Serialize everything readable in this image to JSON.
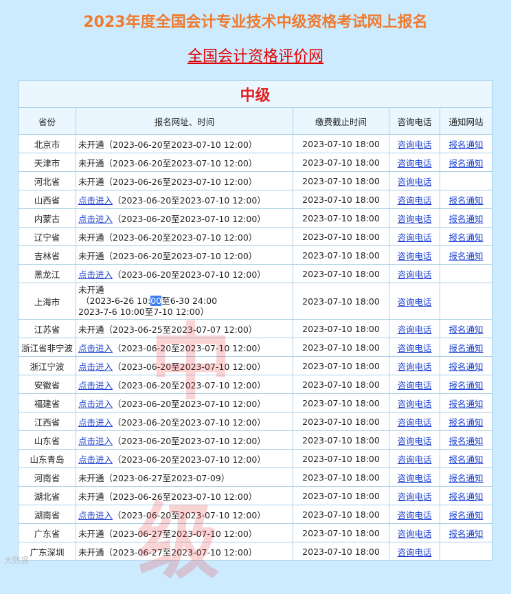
{
  "page": {
    "title": "2023年度全国会计专业技术中级资格考试网上报名",
    "subtitle_link": "全国会计资格评价网"
  },
  "table": {
    "level_title": "中级",
    "headers": [
      "省份",
      "报名网址、时间",
      "缴费截止时间",
      "咨询电话",
      "通知网站"
    ],
    "rows": [
      {
        "province": "北京市",
        "status": "未开通",
        "status_link": false,
        "period": "（2023-06-20至2023-07-10 12:00）",
        "payment_deadline": "2023-07-10 18:00",
        "tel": "咨询电话",
        "notice": "报名通知"
      },
      {
        "province": "天津市",
        "status": "未开通",
        "status_link": false,
        "period": "（2023-06-20至2023-07-10 12:00）",
        "payment_deadline": "2023-07-10 18:00",
        "tel": "咨询电话",
        "notice": "报名通知"
      },
      {
        "province": "河北省",
        "status": "未开通",
        "status_link": false,
        "period": "（2023-06-26至2023-07-10 12:00）",
        "payment_deadline": "2023-07-10 18:00",
        "tel": "咨询电话",
        "notice": ""
      },
      {
        "province": "山西省",
        "status": "点击进入",
        "status_link": true,
        "period": "（2023-06-20至2023-07-10 12:00）",
        "payment_deadline": "2023-07-10 18:00",
        "tel": "咨询电话",
        "notice": "报名通知"
      },
      {
        "province": "内蒙古",
        "status": "点击进入",
        "status_link": true,
        "period": "（2023-06-20至2023-07-10 12:00）",
        "payment_deadline": "2023-07-10 18:00",
        "tel": "咨询电话",
        "notice": "报名通知"
      },
      {
        "province": "辽宁省",
        "status": "未开通",
        "status_link": false,
        "period": "（2023-06-20至2023-07-10 12:00）",
        "payment_deadline": "2023-07-10 18:00",
        "tel": "咨询电话",
        "notice": "报名通知"
      },
      {
        "province": "吉林省",
        "status": "未开通",
        "status_link": false,
        "period": "（2023-06-20至2023-07-10 12:00）",
        "payment_deadline": "2023-07-10 18:00",
        "tel": "咨询电话",
        "notice": "报名通知"
      },
      {
        "province": "黑龙江",
        "status": "点击进入",
        "status_link": true,
        "period": "（2023-06-20至2023-07-10 12:00）",
        "payment_deadline": "2023-07-10 18:00",
        "tel": "咨询电话",
        "notice": ""
      }
    ],
    "shanghai": {
      "province": "上海市",
      "status": "未开通",
      "line2_pre": "（2023-6-26 10:",
      "line2_hl": "00",
      "line2_post": "至6-30 24:00",
      "line3": "2023-7-6 10:00至7-10 12:00）",
      "payment_deadline": "2023-07-10 18:00",
      "tel": "咨询电话",
      "notice": ""
    },
    "rows2": [
      {
        "province": "江苏省",
        "status": "未开通",
        "status_link": false,
        "period": "（2023-06-25至2023-07-07 12:00）",
        "payment_deadline": "2023-07-10 18:00",
        "tel": "咨询电话",
        "notice": "报名通知"
      },
      {
        "province": "浙江省非宁波",
        "status": "点击进入",
        "status_link": true,
        "period": "（2023-06-20至2023-07-10 12:00）",
        "payment_deadline": "2023-07-10 18:00",
        "tel": "咨询电话",
        "notice": "报名通知"
      },
      {
        "province": "浙江宁波",
        "status": "点击进入",
        "status_link": true,
        "period": "（2023-06-20至2023-07-10 12:00）",
        "payment_deadline": "2023-07-10 18:00",
        "tel": "咨询电话",
        "notice": "报名通知"
      },
      {
        "province": "安徽省",
        "status": "点击进入",
        "status_link": true,
        "period": "（2023-06-20至2023-07-10 12:00）",
        "payment_deadline": "2023-07-10 18:00",
        "tel": "咨询电话",
        "notice": "报名通知"
      },
      {
        "province": "福建省",
        "status": "点击进入",
        "status_link": true,
        "period": "（2023-06-20至2023-07-10 12:00）",
        "payment_deadline": "2023-07-10 18:00",
        "tel": "咨询电话",
        "notice": "报名通知"
      },
      {
        "province": "江西省",
        "status": "点击进入",
        "status_link": true,
        "period": "（2023-06-20至2023-07-10 12:00）",
        "payment_deadline": "2023-07-10 18:00",
        "tel": "咨询电话",
        "notice": "报名通知"
      },
      {
        "province": "山东省",
        "status": "点击进入",
        "status_link": true,
        "period": "（2023-06-20至2023-07-10 12:00）",
        "payment_deadline": "2023-07-10 18:00",
        "tel": "咨询电话",
        "notice": "报名通知"
      },
      {
        "province": "山东青岛",
        "status": "点击进入",
        "status_link": true,
        "period": "（2023-06-20至2023-07-10 12:00）",
        "payment_deadline": "2023-07-10 18:00",
        "tel": "咨询电话",
        "notice": "报名通知"
      },
      {
        "province": "河南省",
        "status": "未开通",
        "status_link": false,
        "period": "（2023-06-27至2023-07-09）",
        "payment_deadline": "2023-07-10 18:00",
        "tel": "咨询电话",
        "notice": "报名通知"
      },
      {
        "province": "湖北省",
        "status": "未开通",
        "status_link": false,
        "period": "（2023-06-26至2023-07-10 12:00）",
        "payment_deadline": "2023-07-10 18:00",
        "tel": "咨询电话",
        "notice": "报名通知"
      },
      {
        "province": "湖南省",
        "status": "点击进入",
        "status_link": true,
        "period": "（2023-06-20至2023-07-10 12:00）",
        "payment_deadline": "2023-07-10 18:00",
        "tel": "咨询电话",
        "notice": "报名通知"
      },
      {
        "province": "广东省",
        "status": "未开通",
        "status_link": false,
        "period": "（2023-06-27至2023-07-10 12:00）",
        "payment_deadline": "2023-07-10 18:00",
        "tel": "咨询电话",
        "notice": "报名通知"
      },
      {
        "province": "广东深圳",
        "status": "未开通",
        "status_link": false,
        "period": "（2023-06-27至2023-07-10 12:00）",
        "payment_deadline": "2023-07-10 18:00",
        "tel": "咨询电话",
        "notice": ""
      }
    ]
  },
  "watermark": {
    "char1": "中",
    "char2": "级"
  },
  "corner_mark": "大数据"
}
